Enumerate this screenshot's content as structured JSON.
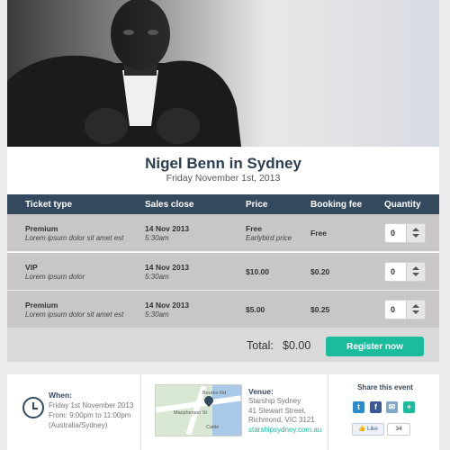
{
  "event": {
    "title": "Nigel Benn in Sydney",
    "date": "Friday November 1st, 2013"
  },
  "table": {
    "headers": [
      "Ticket type",
      "Sales close",
      "Price",
      "Booking fee",
      "Quantity"
    ],
    "rows": [
      {
        "name": "Premium",
        "desc": "Lorem ipsum dolor sit amet est",
        "close_date": "14 Nov 2013",
        "close_time": "5:30am",
        "price": "Free",
        "price_note": "Earlybird price",
        "fee": "Free",
        "qty": "0"
      },
      {
        "name": "VIP",
        "desc": "Lorem ipsum dolor",
        "close_date": "14 Nov 2013",
        "close_time": "5:30am",
        "price": "$10.00",
        "price_note": "",
        "fee": "$0.20",
        "qty": "0"
      },
      {
        "name": "Premium",
        "desc": "Lorem ipsum dolor sit amet est",
        "close_date": "14 Nov 2013",
        "close_time": "5:30am",
        "price": "$5.00",
        "price_note": "",
        "fee": "$0.25",
        "qty": "0"
      }
    ]
  },
  "total": {
    "label": "Total:",
    "value": "$0.00",
    "button": "Register now"
  },
  "when": {
    "label": "When:",
    "lines": [
      "Friday 1st November 2013",
      "From: 9:00pm to 11:00pm",
      "(Australia/Sydney)"
    ]
  },
  "map": {
    "labels": [
      "Bourke Rd",
      "Macpherson St",
      "Cable"
    ]
  },
  "venue": {
    "label": "Venue:",
    "lines": [
      "Starship Sydney",
      "41 Stewart Street,",
      "Richmond, VIC 3121"
    ],
    "link": "starshipsydney.com.au"
  },
  "share": {
    "title": "Share this event",
    "like_label": "Like",
    "like_count": "34",
    "icons": [
      "twitter-icon",
      "facebook-icon",
      "email-icon",
      "plus-icon"
    ]
  },
  "colors": {
    "header": "#34495e",
    "accent": "#1abc9c",
    "row_bg": "#c9c6c7"
  }
}
